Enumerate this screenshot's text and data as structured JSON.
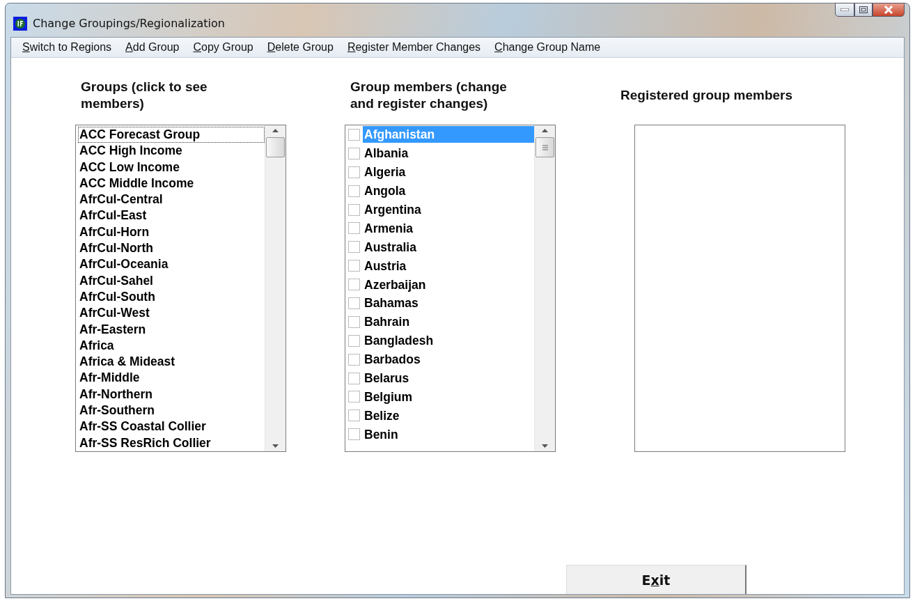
{
  "window": {
    "title": "Change Groupings/Regionalization"
  },
  "menu": [
    {
      "access_key": "S",
      "after_key": "witch to Regions"
    },
    {
      "access_key": "A",
      "after_key": "dd Group"
    },
    {
      "access_key": "C",
      "after_key": "opy Group"
    },
    {
      "access_key": "D",
      "after_key": "elete Group"
    },
    {
      "access_key": "R",
      "after_key": "egister Member Changes"
    },
    {
      "access_key": "C",
      "after_key": "hange Group Name"
    }
  ],
  "groups": {
    "heading": "Groups (click to see members)",
    "items": [
      {
        "label": "ACC Forecast Group",
        "selected": true
      },
      {
        "label": "ACC High Income",
        "selected": false
      },
      {
        "label": "ACC Low Income",
        "selected": false
      },
      {
        "label": "ACC Middle Income",
        "selected": false
      },
      {
        "label": "AfrCul-Central",
        "selected": false
      },
      {
        "label": "AfrCul-East",
        "selected": false
      },
      {
        "label": "AfrCul-Horn",
        "selected": false
      },
      {
        "label": "AfrCul-North",
        "selected": false
      },
      {
        "label": "AfrCul-Oceania",
        "selected": false
      },
      {
        "label": "AfrCul-Sahel",
        "selected": false
      },
      {
        "label": "AfrCul-South",
        "selected": false
      },
      {
        "label": "AfrCul-West",
        "selected": false
      },
      {
        "label": "Afr-Eastern",
        "selected": false
      },
      {
        "label": "Africa",
        "selected": false
      },
      {
        "label": "Africa & Mideast",
        "selected": false
      },
      {
        "label": "Afr-Middle",
        "selected": false
      },
      {
        "label": "Afr-Northern",
        "selected": false
      },
      {
        "label": "Afr-Southern",
        "selected": false
      },
      {
        "label": "Afr-SS Coastal Collier",
        "selected": false
      },
      {
        "label": "Afr-SS ResRich Collier",
        "selected": false
      }
    ]
  },
  "members": {
    "heading": "Group members (change and register changes)",
    "items": [
      {
        "label": "Afghanistan",
        "checked": false,
        "selected": true
      },
      {
        "label": "Albania",
        "checked": false,
        "selected": false
      },
      {
        "label": "Algeria",
        "checked": false,
        "selected": false
      },
      {
        "label": "Angola",
        "checked": false,
        "selected": false
      },
      {
        "label": "Argentina",
        "checked": false,
        "selected": false
      },
      {
        "label": "Armenia",
        "checked": false,
        "selected": false
      },
      {
        "label": "Australia",
        "checked": false,
        "selected": false
      },
      {
        "label": "Austria",
        "checked": false,
        "selected": false
      },
      {
        "label": "Azerbaijan",
        "checked": false,
        "selected": false
      },
      {
        "label": "Bahamas",
        "checked": false,
        "selected": false
      },
      {
        "label": "Bahrain",
        "checked": false,
        "selected": false
      },
      {
        "label": "Bangladesh",
        "checked": false,
        "selected": false
      },
      {
        "label": "Barbados",
        "checked": false,
        "selected": false
      },
      {
        "label": "Belarus",
        "checked": false,
        "selected": false
      },
      {
        "label": "Belgium",
        "checked": false,
        "selected": false
      },
      {
        "label": "Belize",
        "checked": false,
        "selected": false
      },
      {
        "label": "Benin",
        "checked": false,
        "selected": false
      }
    ]
  },
  "registered": {
    "heading": "Registered group members"
  },
  "exit_button": {
    "before_key": "E",
    "access_key": "x",
    "after_key": "it"
  }
}
